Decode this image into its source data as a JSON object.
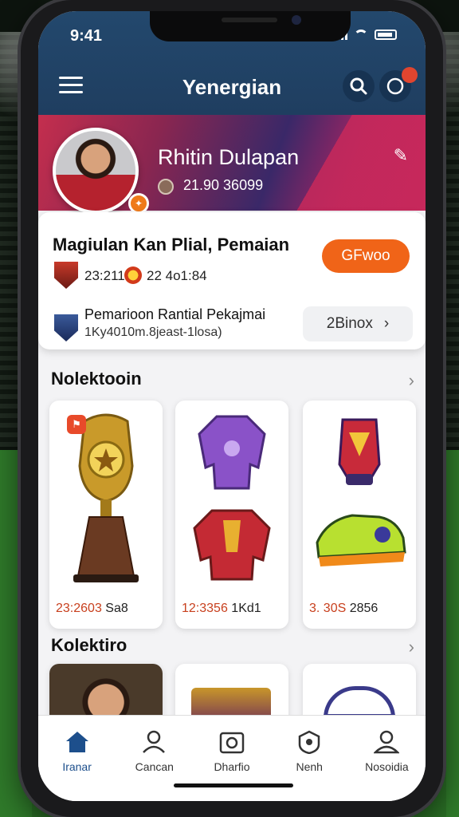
{
  "status_bar": {
    "time": "9:41"
  },
  "header": {
    "title": "Yenergian",
    "notification_count": ""
  },
  "profile": {
    "name": "Rhitin Dulapan",
    "stat": "21.90 36099"
  },
  "info_card": {
    "title": "Magiulan Kan Plial, Pemaian",
    "stat1": "23:211",
    "stat2": "22 4o1:84",
    "cta_label": "GFwoo",
    "row2_title": "Pemarioon Rantial Pekajmai",
    "row2_subtitle": "1Ky4010m.8jeast-1losa)",
    "pill_label": "2Binox"
  },
  "sections": [
    {
      "title": "Nolektooin"
    },
    {
      "title": "Kolektiro"
    }
  ],
  "collection_cards": [
    {
      "item": "trophy",
      "price_a": "23:2603",
      "price_b": "Sa8"
    },
    {
      "item": "jerseys",
      "price_a": "12:3356",
      "price_b": "1Kd1"
    },
    {
      "item": "shoes",
      "price_a": "3. 30S",
      "price_b": "2856"
    }
  ],
  "tabs": [
    {
      "label": "Iranar",
      "icon": "home-icon",
      "active": true
    },
    {
      "label": "Cancan",
      "icon": "user-edit-icon",
      "active": false
    },
    {
      "label": "Dharfio",
      "icon": "camera-icon",
      "active": false
    },
    {
      "label": "Nenh",
      "icon": "badge-icon",
      "active": false
    },
    {
      "label": "Nosoidia",
      "icon": "profile-icon",
      "active": false
    }
  ],
  "colors": {
    "accent_orange": "#f06418",
    "header_blue": "#23486d",
    "banner_magenta": "#c42e4e"
  }
}
